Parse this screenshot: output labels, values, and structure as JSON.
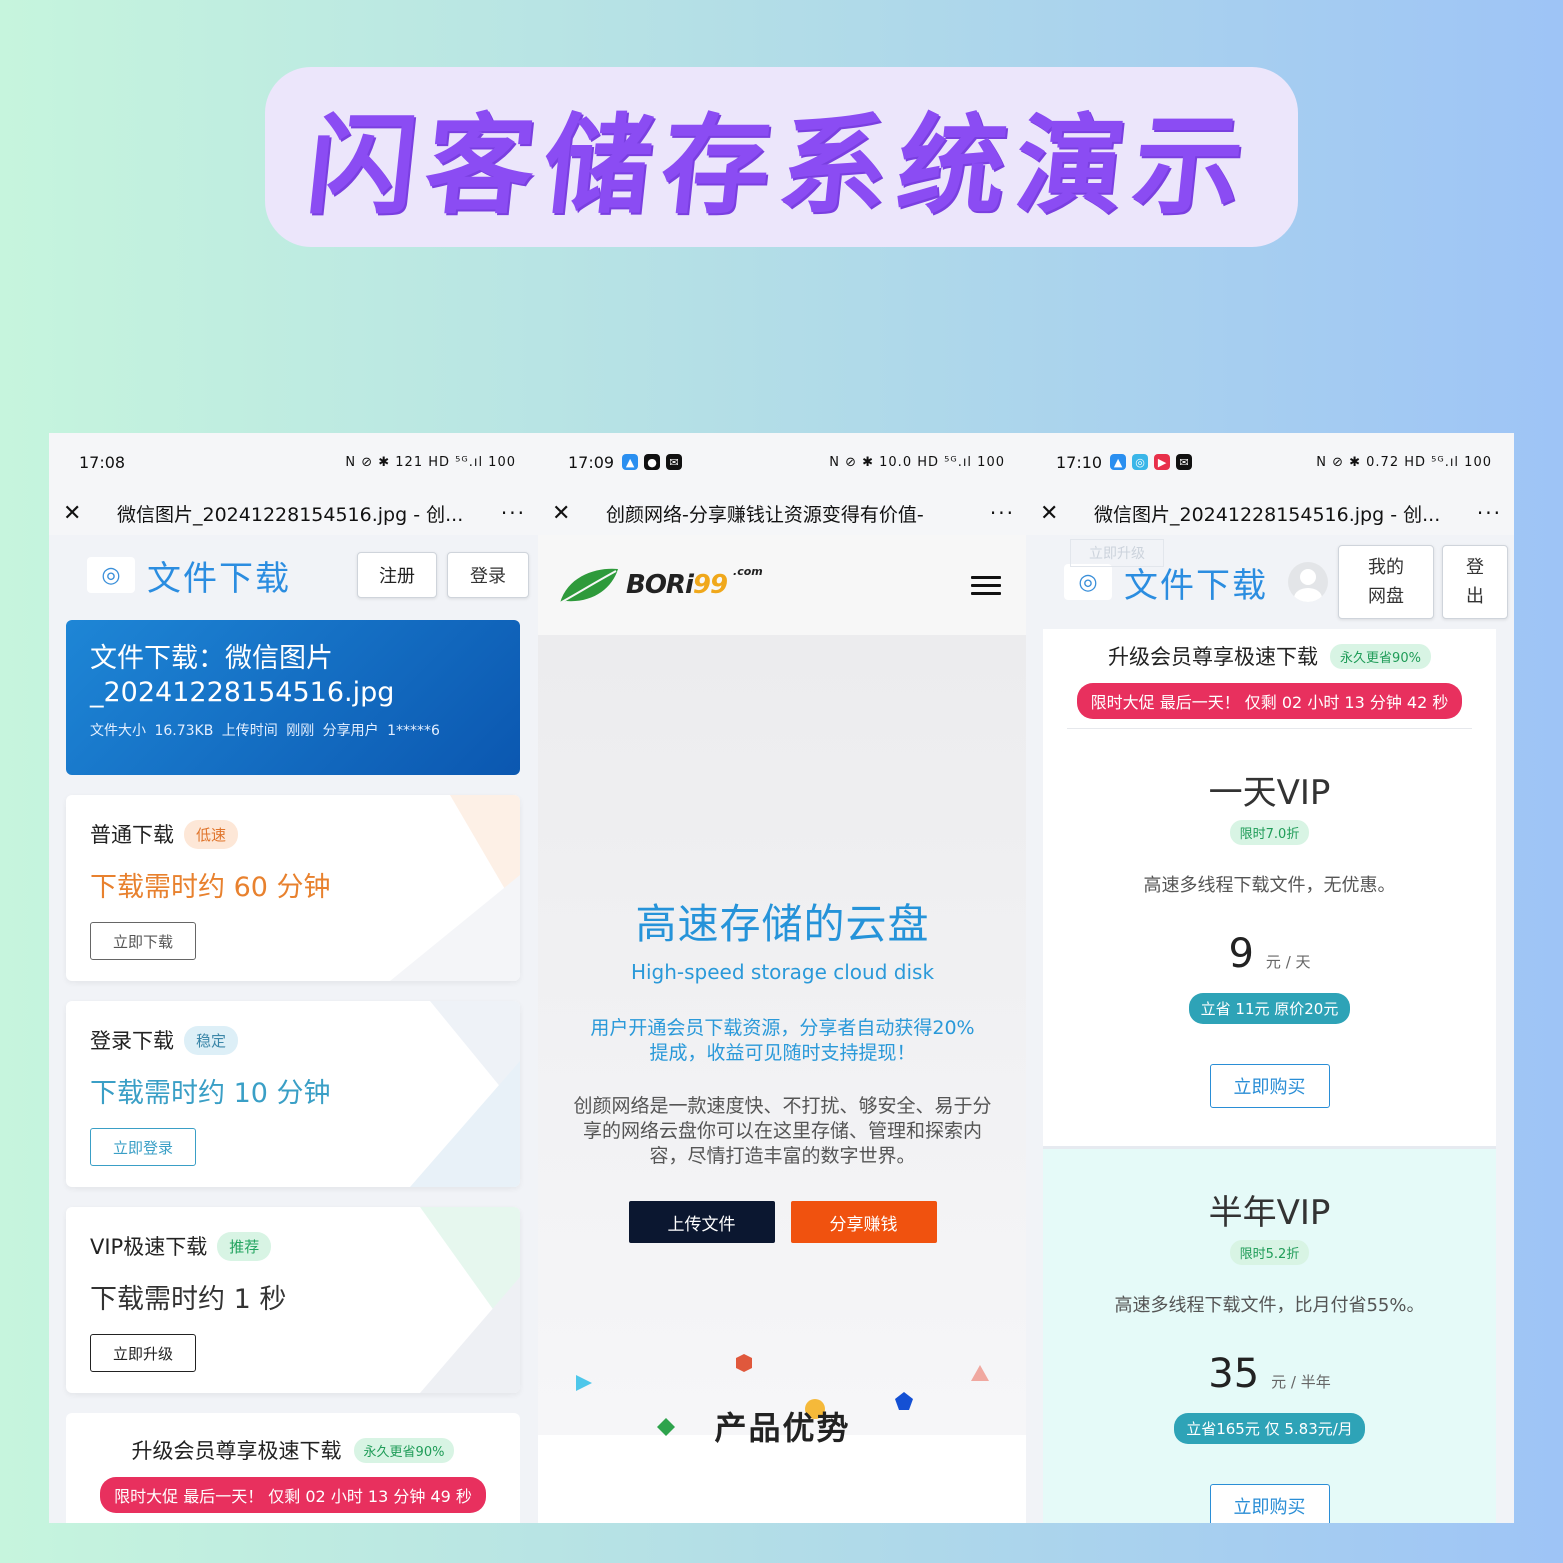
{
  "banner": {
    "title": "闪客储存系统演示"
  },
  "phones": [
    {
      "status": {
        "time": "17:08",
        "icons": "N ⊘ ✱ 121 HD ⁵ᴳ.ıl 100"
      },
      "titlebar": {
        "title": "微信图片_20241228154516.jpg - 创...",
        "more": "···"
      },
      "header": {
        "site_title": "文件下载",
        "register": "注册",
        "login": "登录"
      },
      "file": {
        "name": "文件下载：微信图片_20241228154516.jpg",
        "meta": "文件大小 16.73KB   上传时间 刚刚   分享用户 1*****6"
      },
      "options": [
        {
          "title": "普通下载",
          "tag": "低速",
          "time": "下载需时约 60 分钟",
          "button": "立即下载",
          "color": "#e8812e",
          "btn_color": "#555"
        },
        {
          "title": "登录下载",
          "tag": "稳定",
          "time": "下载需时约 10 分钟",
          "button": "立即登录",
          "color": "#3a9fc6",
          "btn_color": "#3a9fc6"
        },
        {
          "title": "VIP极速下载",
          "tag": "推荐",
          "time": "下载需时约 1 秒",
          "button": "立即升级",
          "color": "#333",
          "btn_color": "#222"
        }
      ],
      "promo": {
        "title": "升级会员尊享极速下载",
        "tag": "永久更省90%",
        "countdown": "限时大促 最后一天！ 仅剩 02 小时 13 分钟 49 秒"
      }
    },
    {
      "status": {
        "time": "17:09",
        "icons": "N ⊘ ✱ 10.0 HD ⁵ᴳ.ıl 100"
      },
      "titlebar": {
        "title": "创颜网络-分享赚钱让资源变得有价值-",
        "more": "···"
      },
      "brand": {
        "name": "BORi",
        "num": "99",
        "suffix": ".com"
      },
      "hero": {
        "title": "高速存储的云盘",
        "subtitle": "High-speed storage cloud disk",
        "para1": "用户开通会员下载资源，分享者自动获得20%提成，收益可见随时支持提现！",
        "para2": "创颜网络是一款速度快、不打扰、够安全、易于分享的网络云盘你可以在这里存储、管理和探索内容，尽情打造丰富的数字世界。",
        "upload_btn": "上传文件",
        "share_btn": "分享赚钱"
      },
      "section_title": "产品优势"
    },
    {
      "status": {
        "time": "17:10",
        "icons": "N ⊘ ✱ 0.72 HD ⁵ᴳ.ıl 100"
      },
      "titlebar": {
        "title": "微信图片_20241228154516.jpg - 创...",
        "more": "···"
      },
      "header": {
        "ghost": "立即升级",
        "site_title": "文件下载",
        "my_disk_1": "我的",
        "my_disk_2": "网盘",
        "logout_1": "登",
        "logout_2": "出"
      },
      "promo": {
        "title": "升级会员尊享极速下载",
        "tag": "永久更省90%",
        "countdown": "限时大促 最后一天！ 仅剩 02 小时 13 分钟 42 秒"
      },
      "plans": [
        {
          "name": "一天VIP",
          "tag": "限时7.0折",
          "desc": "高速多线程下载文件，无优惠。",
          "price": "9",
          "unit": "元 / 天",
          "save": "立省 11元 原价20元",
          "buy": "立即购买"
        },
        {
          "name": "半年VIP",
          "tag": "限时5.2折",
          "desc": "高速多线程下载文件，比月付省55%。",
          "price": "35",
          "unit": "元 / 半年",
          "save": "立省165元 仅 5.83元/月",
          "buy": "立即购买"
        }
      ]
    }
  ],
  "colors": {
    "accent_purple": "#8b4cf3",
    "blue": "#2b8de0",
    "orange_btn": "#f0520f",
    "navy_btn": "#0b1730",
    "red_promo": "#e8305e"
  }
}
